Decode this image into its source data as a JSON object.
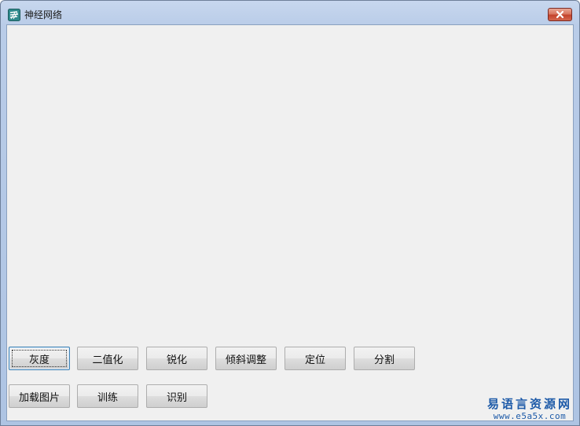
{
  "window": {
    "title": "神经网络",
    "icon": "neural-app-icon"
  },
  "buttons": {
    "row1": [
      {
        "label": "灰度"
      },
      {
        "label": "二值化"
      },
      {
        "label": "锐化"
      },
      {
        "label": "倾斜调整"
      },
      {
        "label": "定位"
      },
      {
        "label": "分割"
      }
    ],
    "row2": [
      {
        "label": "加载图片"
      },
      {
        "label": "训练"
      },
      {
        "label": "识别"
      }
    ]
  },
  "watermark": {
    "text": "易语言资源网",
    "url": "www.e5a5x.com"
  },
  "colors": {
    "client_bg": "#f0f0f0",
    "close_red": "#c4432c",
    "watermark_blue": "#1d5aa8"
  }
}
